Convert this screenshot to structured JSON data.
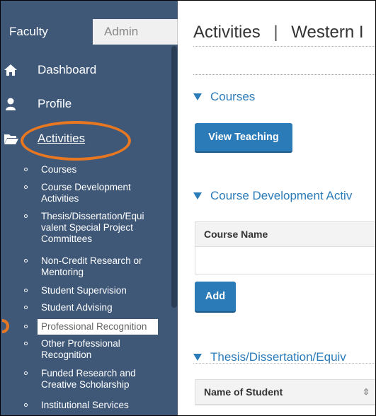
{
  "sidebar": {
    "tabs": {
      "faculty": "Faculty",
      "admin": "Admin"
    },
    "nav": {
      "dashboard": "Dashboard",
      "profile": "Profile",
      "activities": "Activities"
    },
    "sub_items": [
      "Courses",
      "Course Development Activities",
      "Thesis/Dissertation/Equivalent Special Project Committees",
      "Non-Credit Research or Mentoring",
      "Student Supervision",
      "Student Advising",
      "Professional Recognition",
      "Other Professional Recognition",
      "Funded Research and Creative Scholarship",
      "Institutional Services"
    ],
    "sub_items_display": {
      "s0": "Courses",
      "s1a": "Course Development",
      "s1b": "Activities",
      "s2a": "Thesis/Dissertation/Equi",
      "s2b": "valent Special Project",
      "s2c": "Committees",
      "s3a": "Non-Credit Research or",
      "s3b": "Mentoring",
      "s4": "Student Supervision",
      "s5": "Student Advising",
      "s6": "Professional Recognition",
      "s7a": "Other Professional",
      "s7b": "Recognition",
      "s8a": "Funded Research and",
      "s8b": "Creative Scholarship",
      "s9": "Institutional Services"
    },
    "active_sub_item": "Professional Recognition"
  },
  "main": {
    "title": "Activities",
    "title_separator": "|",
    "title_suffix": "Western I",
    "sections": {
      "courses": "Courses",
      "course_dev": "Course Development Activ",
      "thesis": "Thesis/Dissertation/Equiv"
    },
    "buttons": {
      "view_teaching": "View Teaching",
      "add": "Add"
    },
    "tables": {
      "course_name_header": "Course Name",
      "student_name_header": "Name of Student"
    },
    "sort_icon": "⇳"
  },
  "colors": {
    "sidebar_bg": "#3f5878",
    "accent_blue": "#2b7bb9",
    "highlight_orange": "#e87722"
  }
}
